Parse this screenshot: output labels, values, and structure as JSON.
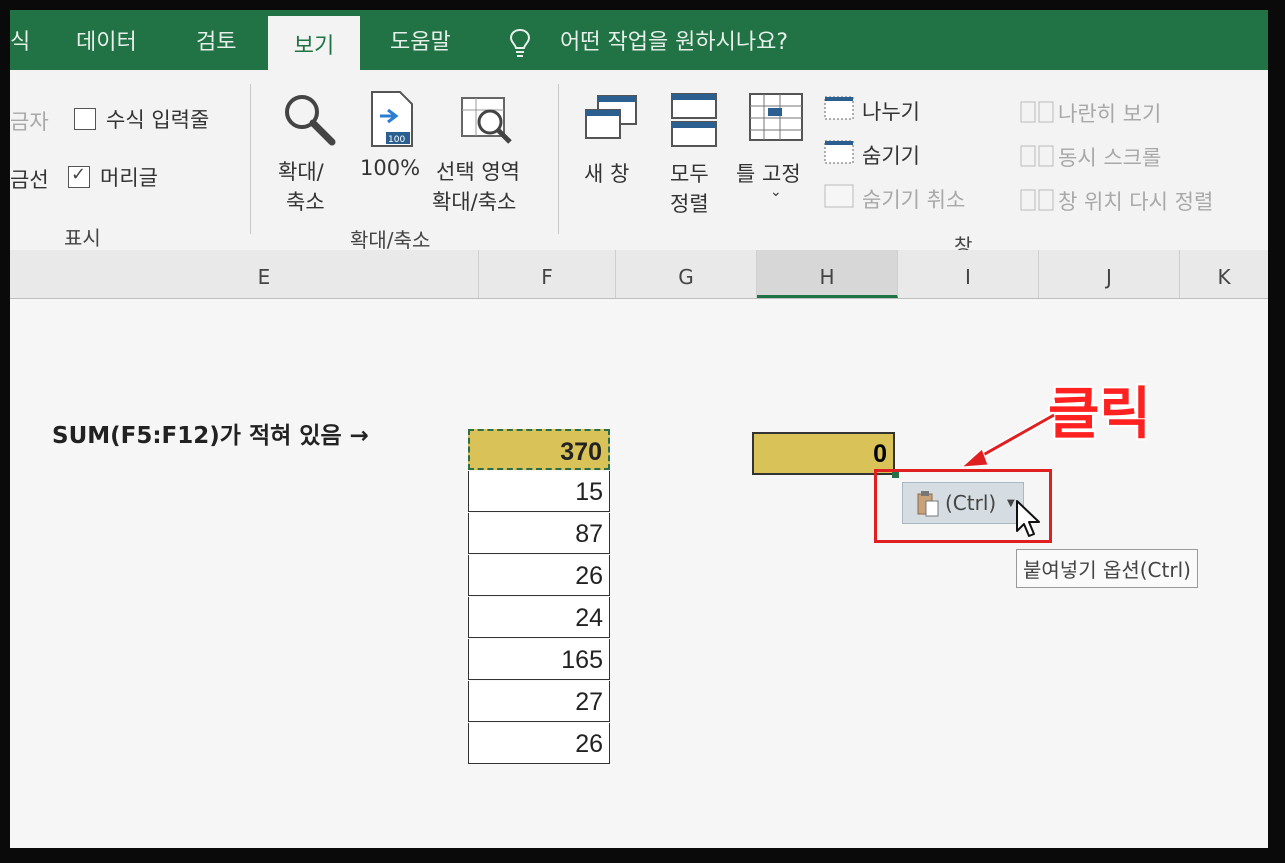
{
  "tabs": [
    "식",
    "데이터",
    "검토",
    "보기",
    "도움말"
  ],
  "active_tab": "보기",
  "tell_me": "어떤 작업을 원하시나요?",
  "ribbon": {
    "show": {
      "row1_partial": "금자",
      "formula_bar": "수식 입력줄",
      "row2_partial": "금선",
      "headings": "머리글",
      "group": "표시"
    },
    "zoom": {
      "zoom_line1": "확대/",
      "zoom_line2": "축소",
      "zoom100": "100%",
      "zoom_sel_line1": "선택 영역",
      "zoom_sel_line2": "확대/축소",
      "group": "확대/축소"
    },
    "window": {
      "new_window": "새 창",
      "arrange_line1": "모두",
      "arrange_line2": "정렬",
      "freeze": "틀 고정",
      "split": "나누기",
      "hide": "숨기기",
      "unhide": "숨기기 취소",
      "side_by_side": "나란히 보기",
      "sync_scroll": "동시 스크롤",
      "reset_position": "창 위치 다시 정렬",
      "group": "창"
    }
  },
  "columns": [
    "E",
    "F",
    "G",
    "H",
    "I",
    "J",
    "K"
  ],
  "selected_column": "H",
  "sheet": {
    "label": "SUM(F5:F12)가 적혀 있음 →",
    "f_values": [
      "370",
      "15",
      "87",
      "26",
      "24",
      "165",
      "27",
      "26"
    ],
    "h_value": "0"
  },
  "paste_options": {
    "button_label": "(Ctrl)",
    "tooltip": "붙여넣기 옵션(Ctrl)"
  },
  "annotation": "클릭",
  "colors": {
    "excel_green": "#217346",
    "cell_highlight": "#d9c257",
    "annotation_red": "#ff2020"
  }
}
